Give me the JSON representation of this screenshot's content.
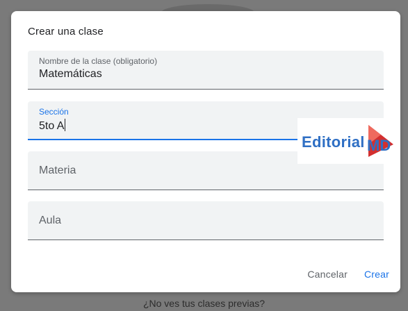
{
  "dialog": {
    "title": "Crear una clase",
    "fields": [
      {
        "label": "Nombre de la clase (obligatorio)",
        "value": "Matemáticas"
      },
      {
        "label": "Sección",
        "value": "5to A"
      },
      {
        "placeholder": "Materia"
      },
      {
        "placeholder": "Aula"
      }
    ],
    "actions": {
      "cancel_label": "Cancelar",
      "create_label": "Crear"
    }
  },
  "background": {
    "footer_text": "¿No ves tus clases previas?"
  },
  "watermark": {
    "text": "Editorial MD"
  },
  "colors": {
    "accent": "#1a73e8",
    "field_bg": "#f1f3f4",
    "overlay": "#7a7a7a",
    "watermark_blue": "#2f6fc4",
    "watermark_red": "#d32f2f"
  }
}
